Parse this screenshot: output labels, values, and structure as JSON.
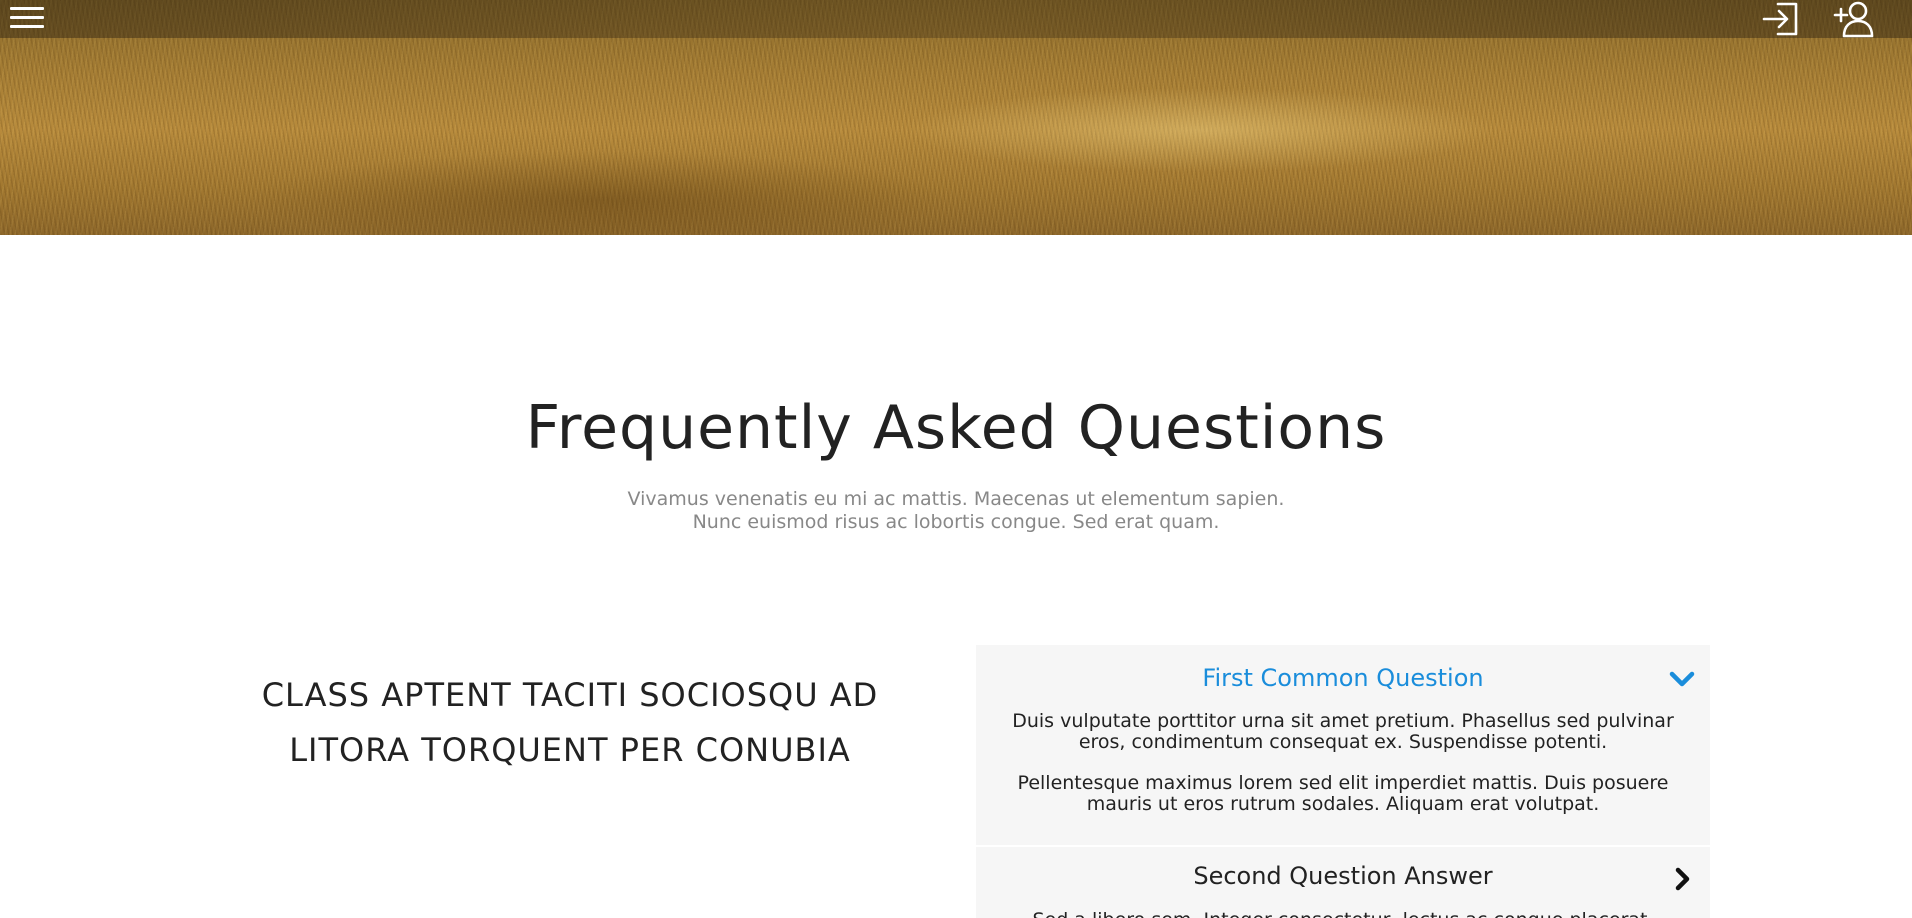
{
  "header": {
    "menu_icon": "hamburger-menu-icon",
    "login_icon": "login-icon",
    "signup_icon": "add-user-icon"
  },
  "hero": {
    "image": "wheat-field-banner"
  },
  "faq": {
    "title": "Frequently Asked Questions",
    "subtitle_line1": "Vivamus venenatis eu mi ac mattis. Maecenas ut elementum sapien.",
    "subtitle_line2": "Nunc euismod risus ac lobortis congue. Sed erat quam.",
    "side_heading_line1": "CLASS APTENT TACITI SOCIOSQU AD",
    "side_heading_line2": "LITORA TORQUENT PER CONUBIA",
    "items": [
      {
        "question": "First Common Question",
        "expanded": true,
        "paragraph1": "Duis vulputate porttitor urna sit amet pretium. Phasellus sed pulvinar eros, condimentum consequat ex. Suspendisse potenti.",
        "paragraph2": "Pellentesque maximus lorem sed elit imperdiet mattis. Duis posuere mauris ut eros rutrum sodales. Aliquam erat volutpat."
      },
      {
        "question": "Second Question Answer",
        "expanded": false,
        "peek_text": "Sed a libero sem. Integer consectetur, lectus ac congue placerat, lacus ex. Quisque"
      }
    ]
  },
  "colors": {
    "accent": "#1a8ddb",
    "panel_bg": "#f6f6f6",
    "subtitle": "#888888",
    "text": "#222222"
  }
}
